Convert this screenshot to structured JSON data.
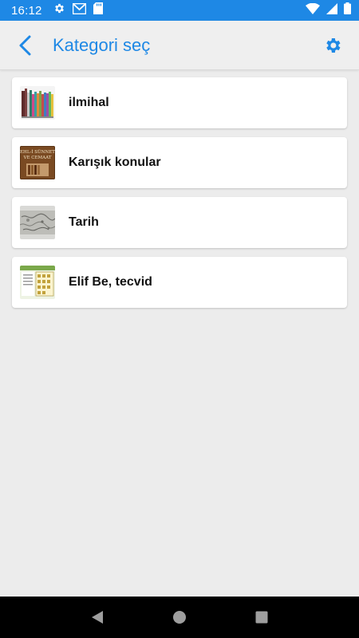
{
  "status_bar": {
    "time": "16:12",
    "icons": [
      "settings-icon",
      "gmail-icon",
      "sd-card-icon",
      "wifi-icon",
      "signal-icon",
      "battery-icon"
    ]
  },
  "app_bar": {
    "title": "Kategori seç",
    "back_icon": "chevron-left-icon",
    "settings_icon": "gear-icon",
    "accent_color": "#1e88e5"
  },
  "categories": [
    {
      "label": "ilmihal",
      "thumbnail": "books-thumbnail"
    },
    {
      "label": "Karışık konular",
      "thumbnail": "ehl-i-sunnet-book-cover",
      "thumb_text": "EHL-İ SÜNNET VE CEMAAT"
    },
    {
      "label": "Tarih",
      "thumbnail": "old-map-thumbnail"
    },
    {
      "label": "Elif Be, tecvid",
      "thumbnail": "alphabet-chart-thumbnail"
    }
  ],
  "nav_bar": {
    "buttons": [
      "back-triangle-icon",
      "home-circle-icon",
      "recents-square-icon"
    ]
  }
}
